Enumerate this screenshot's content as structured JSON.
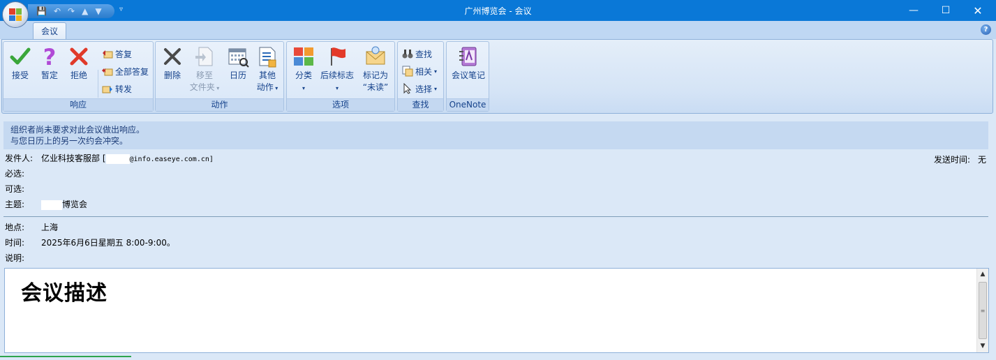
{
  "window": {
    "title": "广州博览会 - 会议",
    "qat": {
      "save": "💾",
      "undo": "↶",
      "redo": "↷",
      "up": "▲",
      "down": "▼",
      "more": "▿"
    },
    "controls": {
      "minimize": "—",
      "maximize": "☐",
      "close": "✕"
    }
  },
  "tabs": [
    {
      "label": "会议",
      "active": true
    }
  ],
  "help": "?",
  "ribbon": {
    "respond": {
      "label": "响应",
      "accept": "接受",
      "tentative": "暂定",
      "decline": "拒绝",
      "reply": "答复",
      "reply_all": "全部答复",
      "forward": "转发"
    },
    "actions": {
      "label": "动作",
      "delete": "删除",
      "move_line1": "移至",
      "move_line2": "文件夹",
      "calendar": "日历",
      "other_line1": "其他",
      "other_line2": "动作"
    },
    "options": {
      "label": "选项",
      "categorize": "分类",
      "follow_up": "后续标志",
      "mark_line1": "标记为",
      "mark_line2": "“未读”"
    },
    "find": {
      "label": "查找",
      "find": "查找",
      "related": "相关",
      "select": "选择"
    },
    "onenote": {
      "label": "OneNote",
      "meeting_notes": "会议笔记"
    }
  },
  "infobar": {
    "line1": "组织者尚未要求对此会议做出响应。",
    "line2": "与您日历上的另一次约会冲突。"
  },
  "header": {
    "from_label": "发件人:",
    "from_name": "亿业科技客服部 [",
    "from_email_suffix": "@info.easeye.com.cn]",
    "required_label": "必选:",
    "optional_label": "可选:",
    "subject_label": "主题:",
    "subject_value": "博览会",
    "sent_label": "发送时间:",
    "sent_value": "无",
    "location_label": "地点:",
    "location_value": "上海",
    "time_label": "时间:",
    "time_value": "2025年6月6日星期五 8:00-9:00。",
    "description_label": "说明:"
  },
  "body": {
    "heading": "会议描述"
  },
  "scrollbar": {
    "up": "▲",
    "down": "▼",
    "grip": "≡"
  }
}
